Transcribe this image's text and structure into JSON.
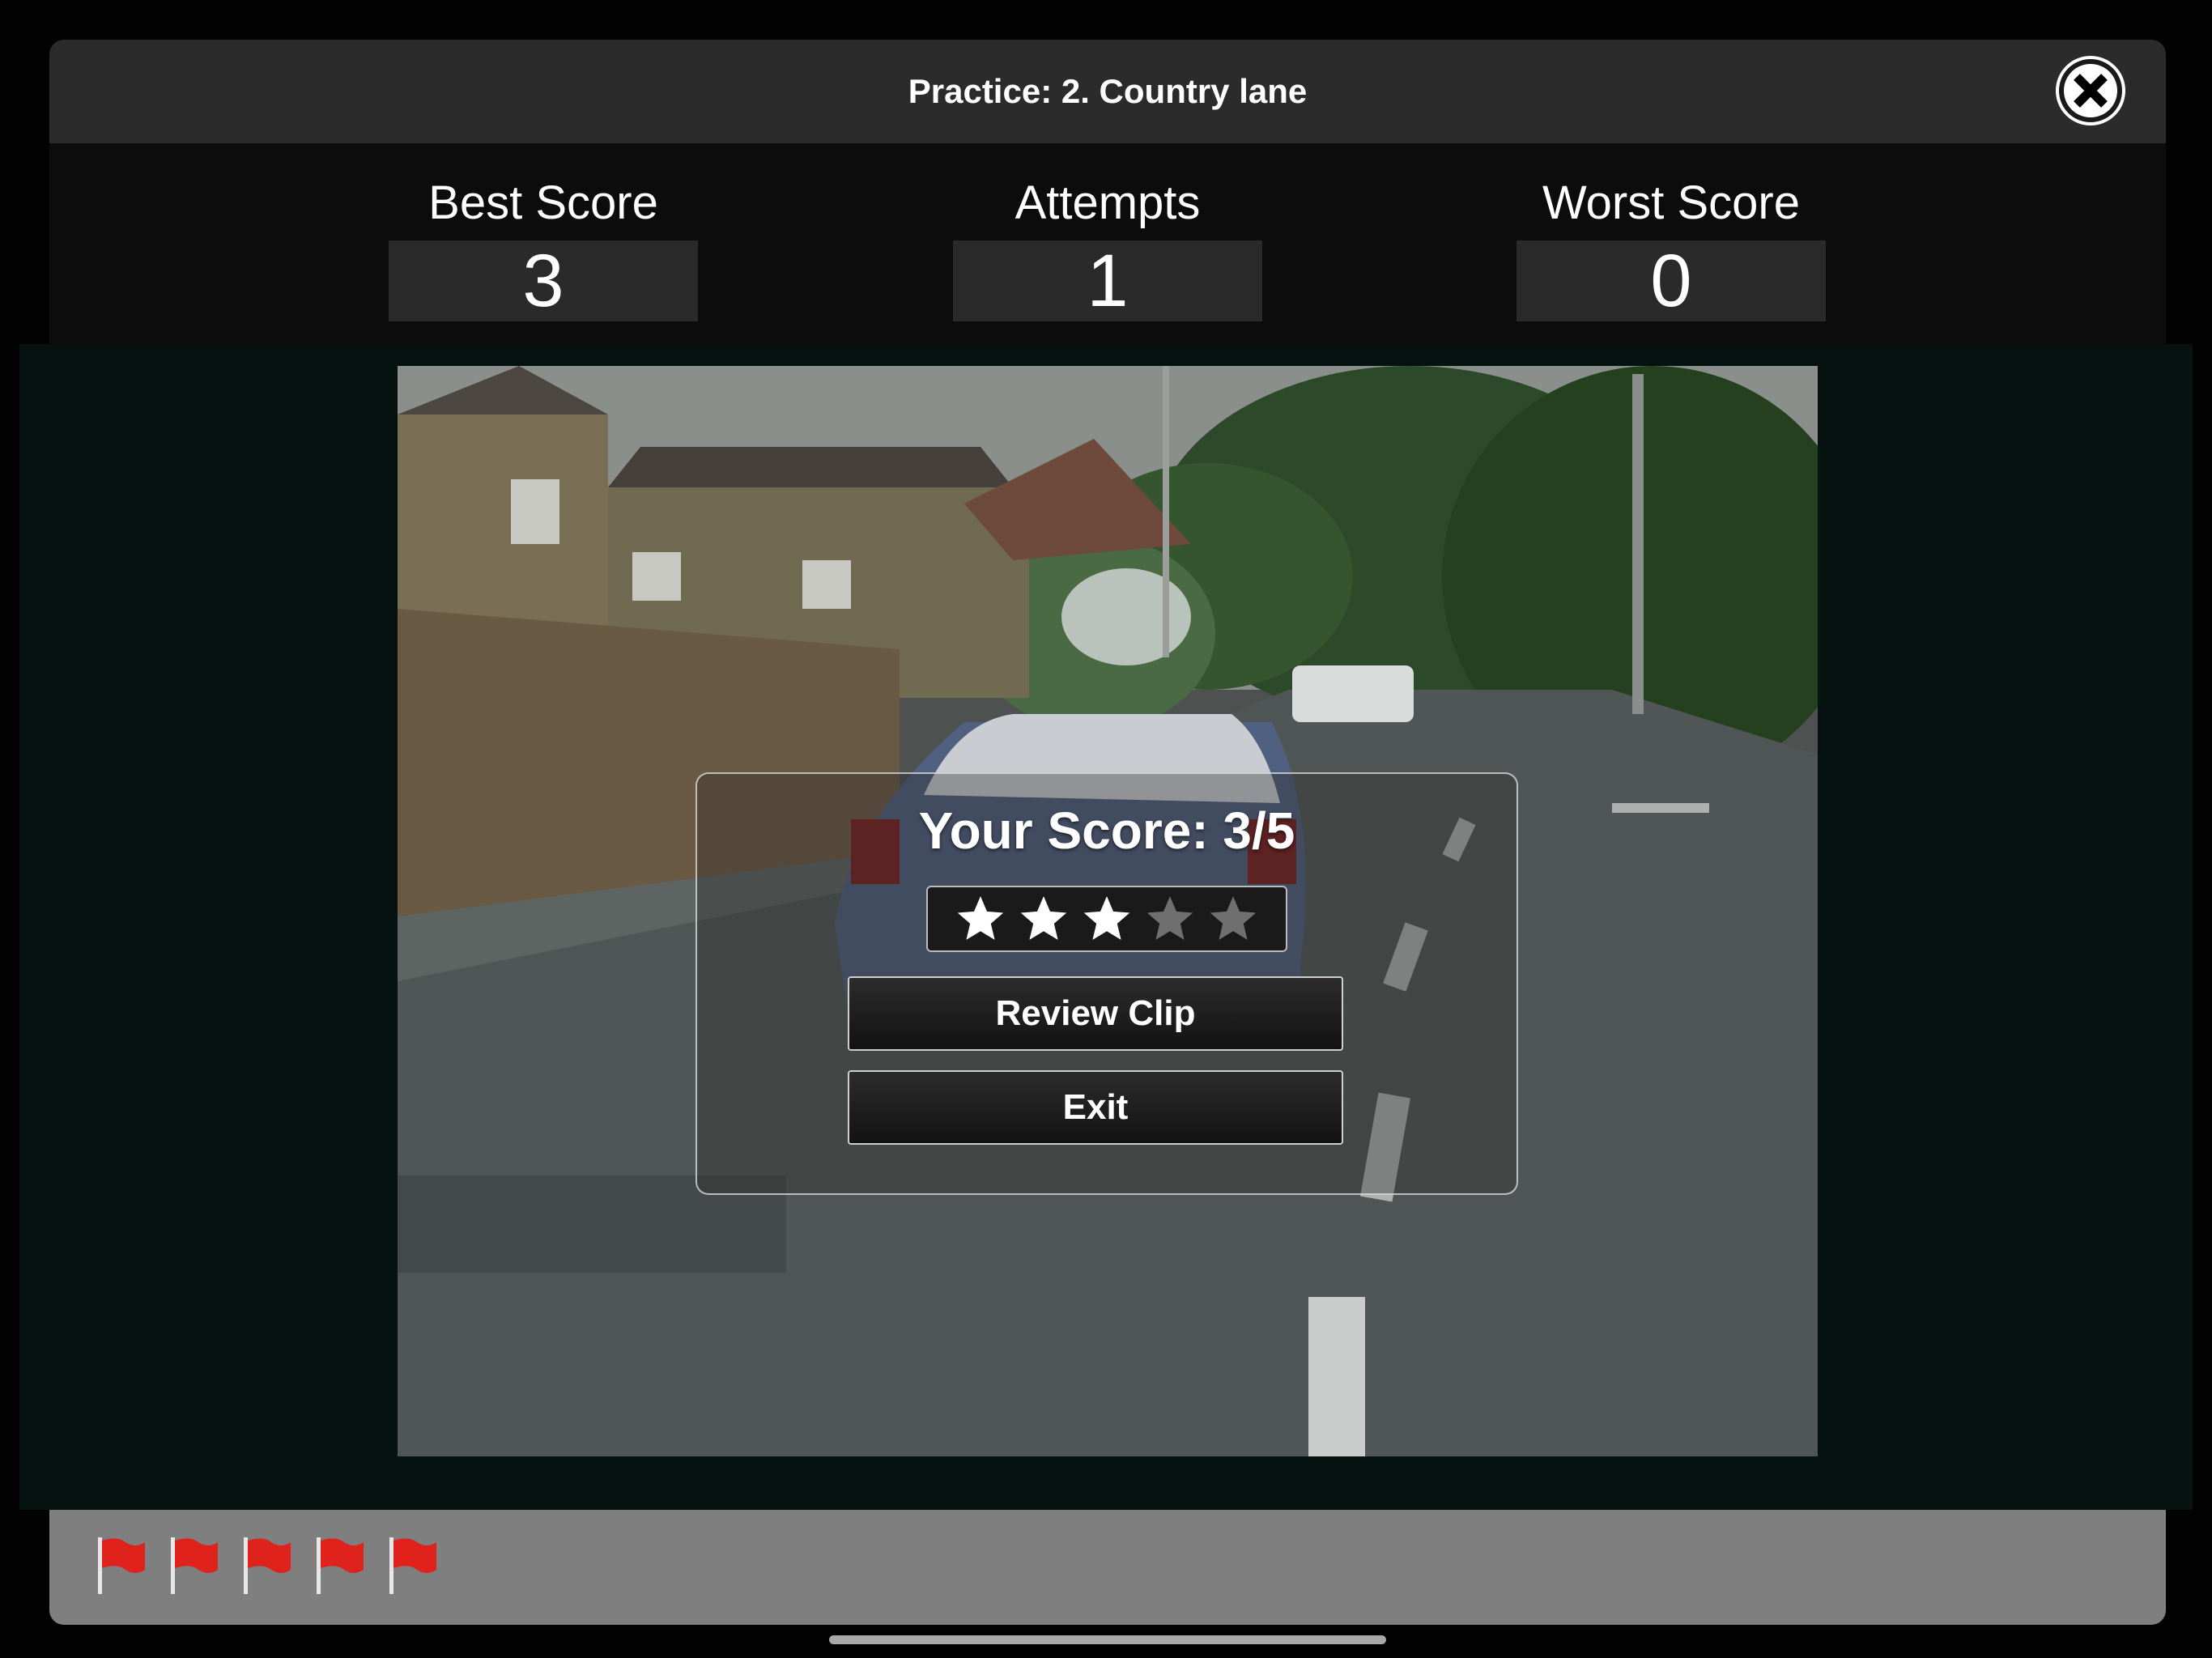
{
  "header": {
    "title": "Practice: 2. Country lane",
    "close_icon": "close-x-icon"
  },
  "stats": {
    "best_score_label": "Best Score",
    "best_score_value": "3",
    "attempts_label": "Attempts",
    "attempts_value": "1",
    "worst_score_label": "Worst Score",
    "worst_score_value": "0"
  },
  "video": {
    "scene": "road-scene-video-frame"
  },
  "result_dialog": {
    "score_text": "Your Score: 3/5",
    "rating": {
      "filled": 3,
      "total": 5
    },
    "review_button_label": "Review Clip",
    "exit_button_label": "Exit"
  },
  "flags": {
    "count": 5,
    "icon": "red-flag-icon"
  },
  "colors": {
    "title_bar": "#2b2b2b",
    "stats_bg": "#0c0c0c",
    "value_box": "#2a2a2a",
    "flag_bar": "#7f7f7f",
    "star_filled": "#ffffff",
    "star_empty": "#6f6f6f",
    "flag_red": "#e0221c"
  }
}
